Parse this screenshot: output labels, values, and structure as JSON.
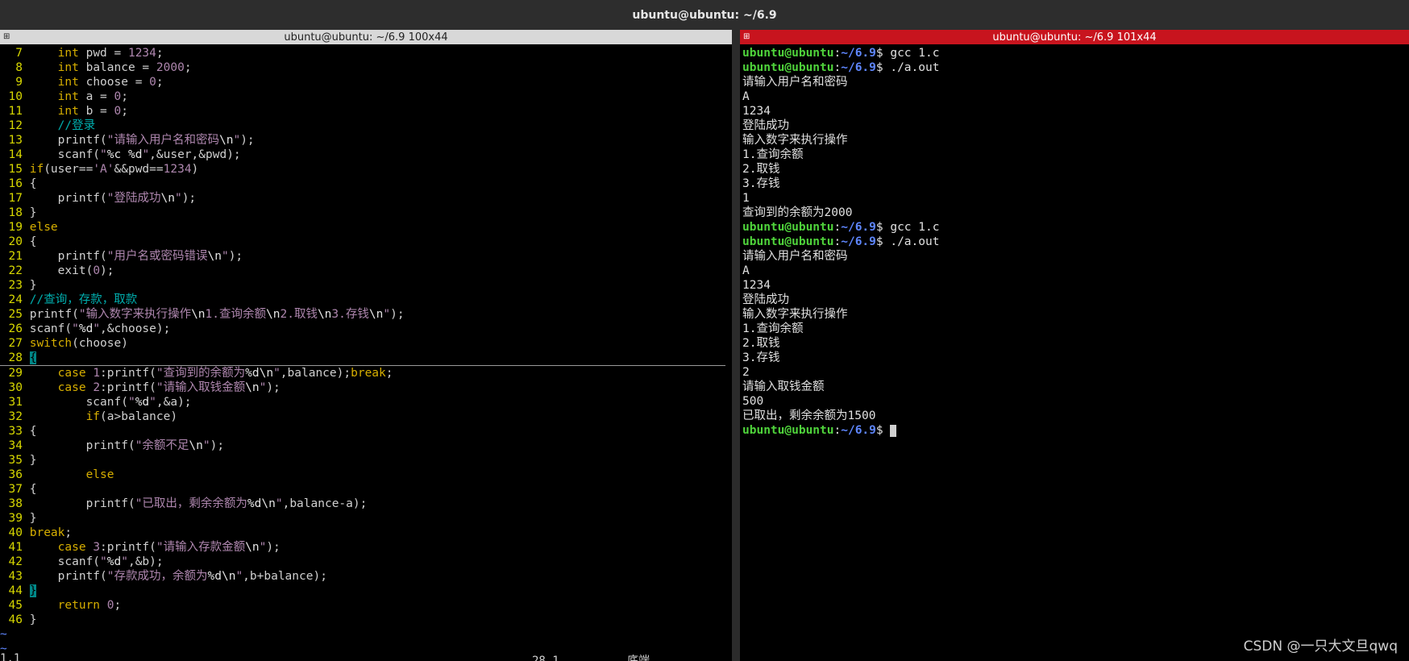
{
  "window": {
    "title": "ubuntu@ubuntu: ~/6.9"
  },
  "left_pane": {
    "title": "ubuntu@ubuntu: ~/6.9 100x44",
    "status_left": "1,1",
    "status_right": "28,1          底端"
  },
  "right_pane": {
    "title": "ubuntu@ubuntu: ~/6.9 101x44"
  },
  "code_lines": [
    {
      "n": "7",
      "t": "    int pwd = 1234;"
    },
    {
      "n": "8",
      "t": "    int balance = 2000;"
    },
    {
      "n": "9",
      "t": "    int choose = 0;"
    },
    {
      "n": "10",
      "t": "    int a = 0;"
    },
    {
      "n": "11",
      "t": "    int b = 0;"
    },
    {
      "n": "12",
      "t": "    //登录"
    },
    {
      "n": "13",
      "t": "    printf(\"请输入用户名和密码\\n\");"
    },
    {
      "n": "14",
      "t": "    scanf(\"%c %d\",&user,&pwd);"
    },
    {
      "n": "15",
      "t": "if(user=='A'&&pwd==1234)"
    },
    {
      "n": "16",
      "t": "{"
    },
    {
      "n": "17",
      "t": "    printf(\"登陆成功\\n\");"
    },
    {
      "n": "18",
      "t": "}"
    },
    {
      "n": "19",
      "t": "else"
    },
    {
      "n": "20",
      "t": "{"
    },
    {
      "n": "21",
      "t": "    printf(\"用户名或密码错误\\n\");"
    },
    {
      "n": "22",
      "t": "    exit(0);"
    },
    {
      "n": "23",
      "t": "}"
    },
    {
      "n": "24",
      "t": "//查询，存款，取款"
    },
    {
      "n": "25",
      "t": "printf(\"输入数字来执行操作\\n1.查询余额\\n2.取钱\\n3.存钱\\n\");"
    },
    {
      "n": "26",
      "t": "scanf(\"%d\",&choose);"
    },
    {
      "n": "27",
      "t": "switch(choose)"
    },
    {
      "n": "28",
      "t": "{"
    },
    {
      "n": "29",
      "t": "    case 1:printf(\"查询到的余额为%d\\n\",balance);break;"
    },
    {
      "n": "30",
      "t": "    case 2:printf(\"请输入取钱金额\\n\");"
    },
    {
      "n": "31",
      "t": "        scanf(\"%d\",&a);"
    },
    {
      "n": "32",
      "t": "        if(a>balance)"
    },
    {
      "n": "33",
      "t": "{"
    },
    {
      "n": "34",
      "t": "        printf(\"余额不足\\n\");"
    },
    {
      "n": "35",
      "t": "}"
    },
    {
      "n": "36",
      "t": "        else"
    },
    {
      "n": "37",
      "t": "{"
    },
    {
      "n": "38",
      "t": "        printf(\"已取出，剩余余额为%d\\n\",balance-a);"
    },
    {
      "n": "39",
      "t": "}"
    },
    {
      "n": "40",
      "t": "break;"
    },
    {
      "n": "41",
      "t": "    case 3:printf(\"请输入存款金额\\n\");"
    },
    {
      "n": "42",
      "t": "    scanf(\"%d\",&b);"
    },
    {
      "n": "43",
      "t": "    printf(\"存款成功，余额为%d\\n\",b+balance);"
    },
    {
      "n": "44",
      "t": "}"
    },
    {
      "n": "45",
      "t": "    return 0;"
    },
    {
      "n": "46",
      "t": "}"
    }
  ],
  "tilde_lines": [
    "~",
    "~"
  ],
  "terminal_lines": [
    {
      "prompt": true,
      "user": "ubuntu@ubuntu",
      "path": "~/6.9",
      "cmd": "gcc 1.c"
    },
    {
      "prompt": true,
      "user": "ubuntu@ubuntu",
      "path": "~/6.9",
      "cmd": "./a.out"
    },
    {
      "text": "请输入用户名和密码"
    },
    {
      "text": "A"
    },
    {
      "text": "1234"
    },
    {
      "text": "登陆成功"
    },
    {
      "text": "输入数字来执行操作"
    },
    {
      "text": "1.查询余额"
    },
    {
      "text": "2.取钱"
    },
    {
      "text": "3.存钱"
    },
    {
      "text": "1"
    },
    {
      "text": "查询到的余额为2000"
    },
    {
      "prompt": true,
      "user": "ubuntu@ubuntu",
      "path": "~/6.9",
      "cmd": "gcc 1.c"
    },
    {
      "prompt": true,
      "user": "ubuntu@ubuntu",
      "path": "~/6.9",
      "cmd": "./a.out"
    },
    {
      "text": "请输入用户名和密码"
    },
    {
      "text": "A"
    },
    {
      "text": "1234"
    },
    {
      "text": "登陆成功"
    },
    {
      "text": "输入数字来执行操作"
    },
    {
      "text": "1.查询余额"
    },
    {
      "text": "2.取钱"
    },
    {
      "text": "3.存钱"
    },
    {
      "text": "2"
    },
    {
      "text": "请输入取钱金额"
    },
    {
      "text": "500"
    },
    {
      "text": "已取出，剩余余额为1500"
    },
    {
      "prompt": true,
      "user": "ubuntu@ubuntu",
      "path": "~/6.9",
      "cmd": "",
      "cursor": true
    }
  ],
  "watermark": "CSDN @一只大文旦qwq",
  "colors": {
    "line_number": "#d7d700",
    "keyword": "#d7af00",
    "string": "#af87af",
    "comment": "#00afaf",
    "prompt_user": "#4fd33b",
    "prompt_path": "#5f87ff",
    "right_title_bg": "#c8141e"
  }
}
